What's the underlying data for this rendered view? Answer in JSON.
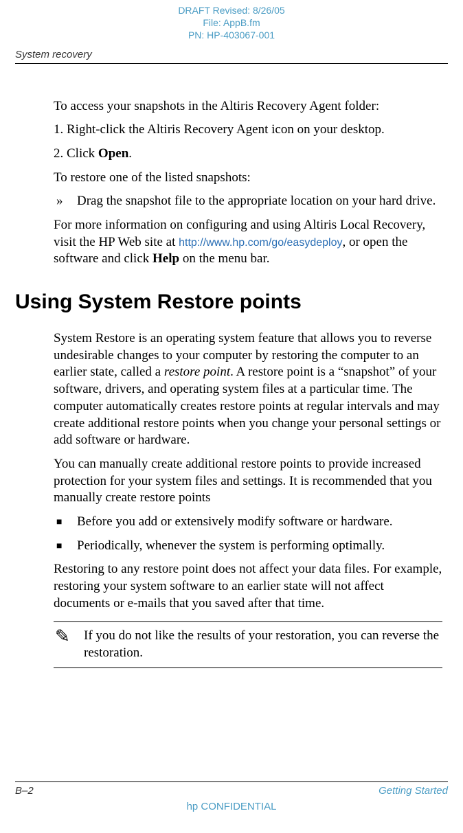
{
  "draft": {
    "line1": "DRAFT Revised: 8/26/05",
    "line2": "File: AppB.fm",
    "line3": "PN: HP-403067-001"
  },
  "running_header": "System recovery",
  "body": {
    "p1": "To access your snapshots in the Altiris Recovery Agent folder:",
    "ol1_prefix": "1. ",
    "ol1": "Right-click the Altiris Recovery Agent icon on your desktop.",
    "ol2_prefix": "2. ",
    "ol2_a": "Click ",
    "ol2_bold": "Open",
    "ol2_b": ".",
    "p2": "To restore one of the listed snapshots:",
    "arrow_bullet": "»",
    "arrow1": "Drag the snapshot file to the appropriate location on your hard drive.",
    "p3a": "For more information on configuring and using Altiris Local Recovery, visit the HP Web site at ",
    "p3_link": "http://www.hp.com/go/easydeploy",
    "p3b": ", or open the software and click ",
    "p3_bold": "Help",
    "p3c": " on the menu bar.",
    "h1": "Using System Restore points",
    "p4a": "System Restore is an operating system feature that allows you to reverse undesirable changes to your computer by restoring the computer to an earlier state, called a ",
    "p4_italic": "restore point",
    "p4b": ". A restore point is a “snapshot” of your software, drivers, and operating system files at a particular time. The computer automatically creates restore points at regular intervals and may create additional restore points when you change your personal settings or add software or hardware.",
    "p5": "You can manually create additional restore points to provide increased protection for your system files and settings. It is recommended that you manually create restore points",
    "sq_bullet": "■",
    "sq1": "Before you add or extensively modify software or hardware.",
    "sq2": "Periodically, whenever the system is performing optimally.",
    "p6": "Restoring to any restore point does not affect your data files. For example, restoring your system software to an earlier state will not affect documents or e-mails that you saved after that time.",
    "note_icon": "✎",
    "note": "If you do not like the results of your restoration, you can reverse the restoration."
  },
  "footer": {
    "page": "B–2",
    "title": "Getting Started",
    "confidential": "hp CONFIDENTIAL"
  }
}
